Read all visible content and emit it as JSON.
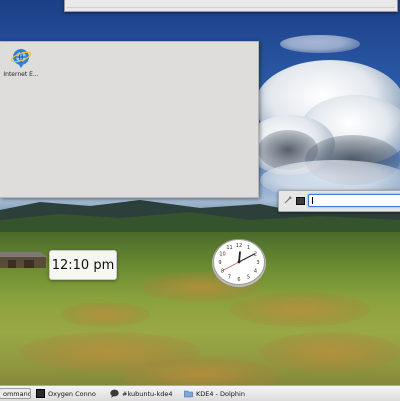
{
  "desktop": {
    "icons": [
      {
        "label": "Internet E...",
        "icon": "internet-explorer-icon"
      }
    ]
  },
  "digital_clock": {
    "time": "12:10 pm"
  },
  "analog_clock": {
    "hour": 12,
    "minute": 10,
    "second": 40
  },
  "run_dialog": {
    "value": ""
  },
  "taskbar": {
    "tasks": [
      {
        "label": "ommand",
        "icon": "terminal-icon"
      },
      {
        "label": "Oxygen Conno",
        "icon": "terminal-icon"
      },
      {
        "label": "#kubuntu-kde4",
        "icon": "chat-bubble-icon"
      },
      {
        "label": "KDE4 - Dolphin",
        "icon": "folder-icon"
      }
    ]
  },
  "colors": {
    "accent": "#3d7ad8",
    "panel": "#dcdcdc",
    "window": "#dedddc"
  }
}
